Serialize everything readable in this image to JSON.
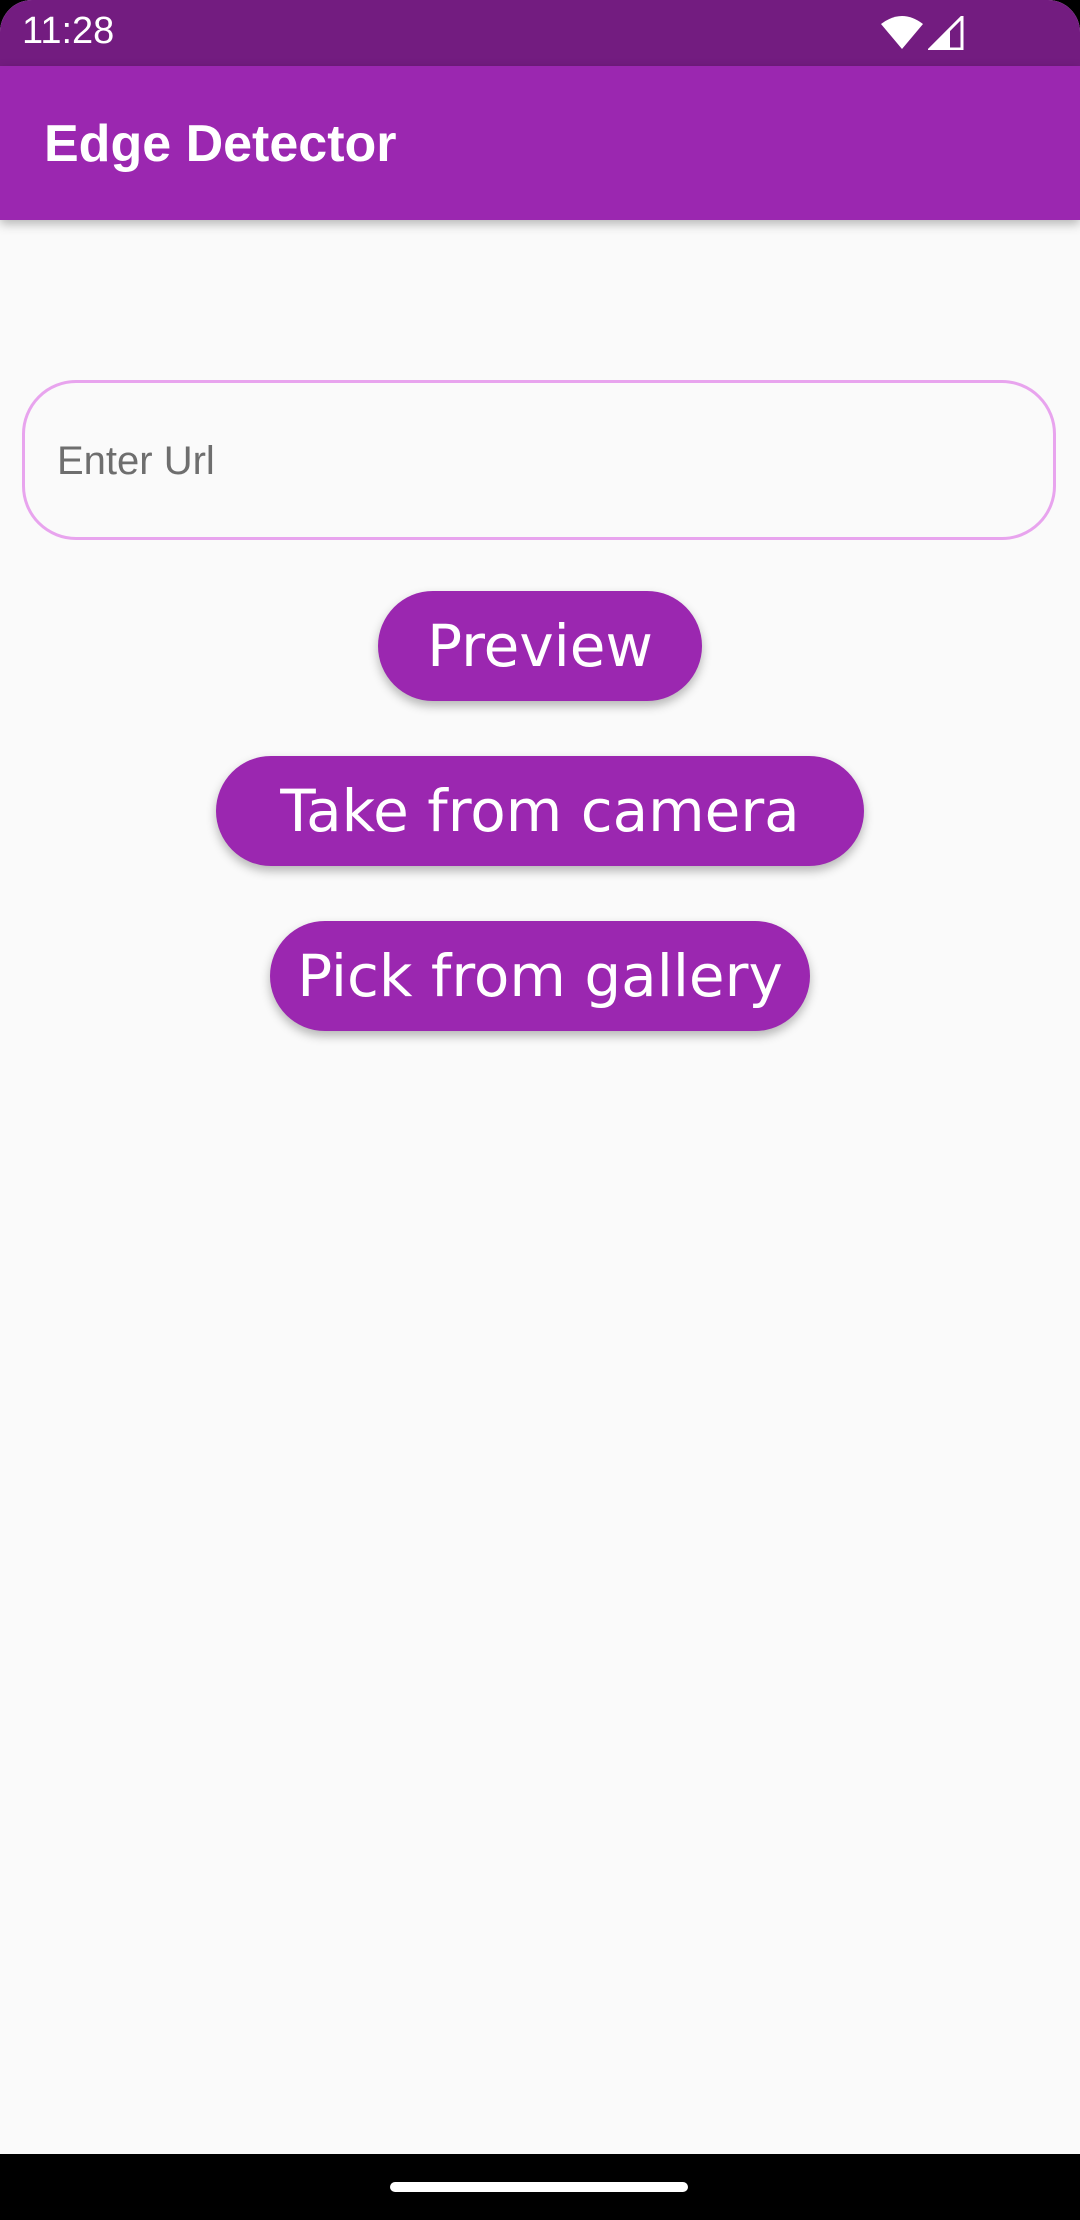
{
  "status_bar": {
    "time": "11:28",
    "icons": [
      "wifi-icon",
      "signal-icon"
    ]
  },
  "app_bar": {
    "title": "Edge Detector",
    "color": "#9b27b0"
  },
  "url_field": {
    "placeholder": "Enter Url",
    "value": "",
    "border_color": "#e8a4ee"
  },
  "buttons": {
    "preview_label": "Preview",
    "camera_label": "Take from camera",
    "gallery_label": "Pick from gallery",
    "color": "#9b27b0"
  }
}
